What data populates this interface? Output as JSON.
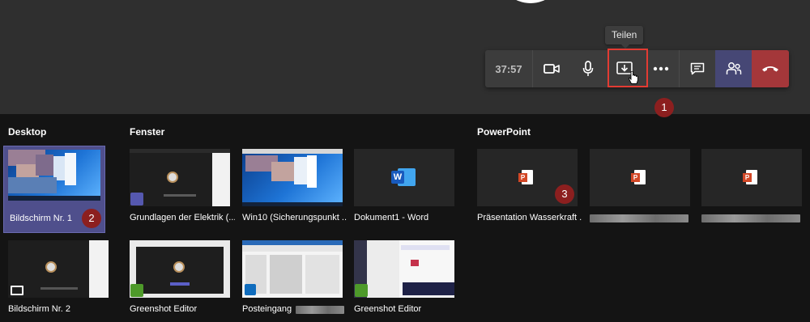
{
  "call": {
    "timer": "37:57",
    "tooltip": "Teilen",
    "controls": [
      "camera-icon",
      "microphone-icon",
      "share-tray-icon",
      "more-options-icon",
      "chat-icon",
      "participants-icon",
      "hang-up-icon"
    ]
  },
  "annotations": {
    "one": "1",
    "two": "2",
    "three": "3"
  },
  "sections": {
    "desktop": "Desktop",
    "windows": "Fenster",
    "powerpoint": "PowerPoint"
  },
  "desktop_tiles": [
    {
      "label": "Bildschirm Nr. 1",
      "selected": true
    },
    {
      "label": "Bildschirm Nr. 2",
      "selected": false
    }
  ],
  "window_tiles": [
    {
      "label": "Grundlagen der Elektrik (..."
    },
    {
      "label": "Win10 (Sicherungspunkt ..."
    },
    {
      "label": "Dokument1 - Word"
    },
    {
      "label": "Greenshot Editor"
    },
    {
      "label": "Posteingang"
    },
    {
      "label": "Greenshot Editor"
    }
  ],
  "powerpoint_tiles": [
    {
      "label": "Präsentation Wasserkraft ..."
    },
    {
      "label": ""
    },
    {
      "label": ""
    }
  ],
  "colors": {
    "accent_purple": "#464775",
    "hangup_red": "#a4373a",
    "highlight_red": "#e23b33",
    "badge_red": "#8c1f1f"
  }
}
